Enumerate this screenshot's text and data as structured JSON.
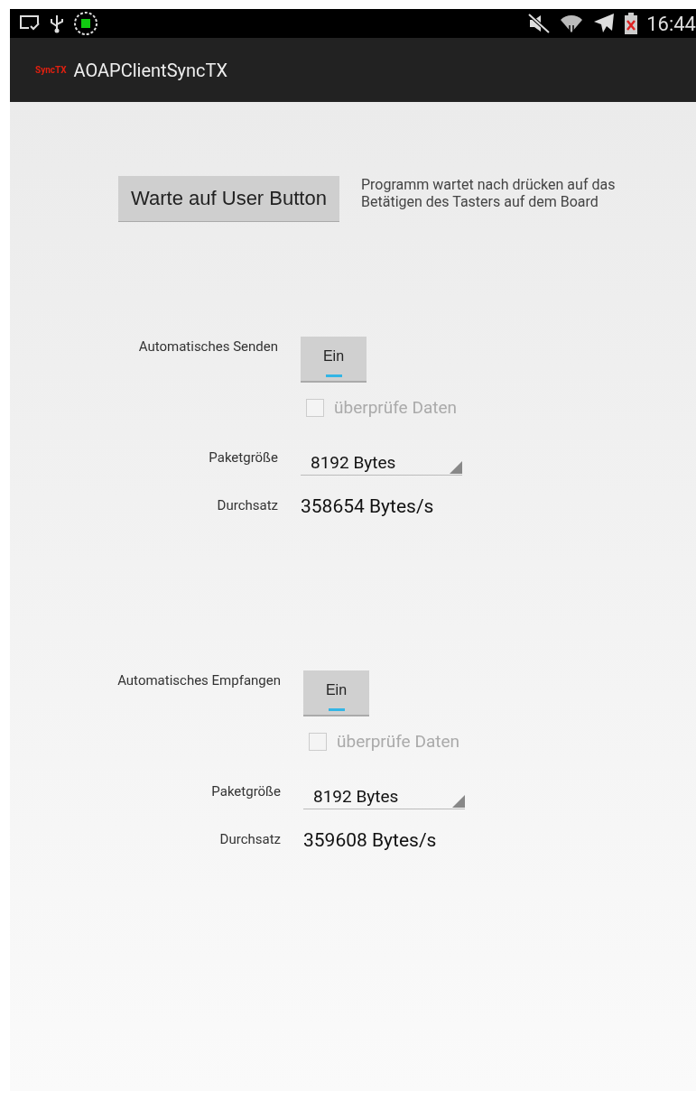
{
  "status_bar": {
    "time": "16:44"
  },
  "app_bar": {
    "logo": "SyncTX",
    "title": "AOAPClientSyncTX"
  },
  "wait_button": {
    "label": "Warte auf User Button",
    "description": "Programm wartet nach drücken auf das Betätigen des Tasters auf dem Board"
  },
  "sections": [
    {
      "label": "Automatisches Senden",
      "toggle": {
        "label": "Ein",
        "on": true
      },
      "checkbox": {
        "label": "überprüfe Daten",
        "checked": false,
        "disabled": true
      },
      "packet_size": {
        "label": "Paketgröße",
        "value": "8192 Bytes"
      },
      "throughput": {
        "label": "Durchsatz",
        "value": "358654 Bytes/s"
      }
    },
    {
      "label": "Automatisches Empfangen",
      "toggle": {
        "label": "Ein",
        "on": true
      },
      "checkbox": {
        "label": "überprüfe Daten",
        "checked": false,
        "disabled": true
      },
      "packet_size": {
        "label": "Paketgröße",
        "value": "8192 Bytes"
      },
      "throughput": {
        "label": "Durchsatz",
        "value": "359608 Bytes/s"
      }
    }
  ]
}
